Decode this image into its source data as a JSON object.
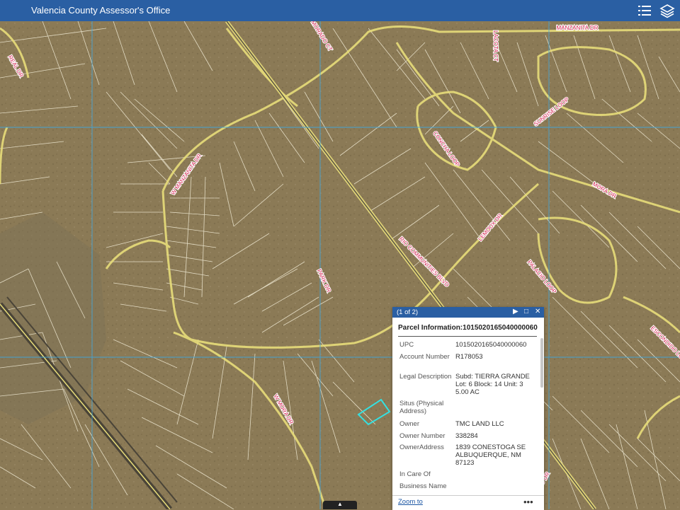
{
  "app": {
    "title": "Valencia County Assessor's Office",
    "icons": [
      "list-icon",
      "layers-icon"
    ]
  },
  "map": {
    "road_labels": [
      {
        "text": "MANZANITA DR"
      },
      {
        "text": "W MANZANITA DR"
      },
      {
        "text": "MORADO CT"
      },
      {
        "text": "LACOTA CT"
      },
      {
        "text": "SUNRISE LOOP"
      },
      {
        "text": "CONCHA LOOP"
      },
      {
        "text": "MORA DR"
      },
      {
        "text": "LEMOUX DR"
      },
      {
        "text": "RIO COMMUNITIES BLVD"
      },
      {
        "text": "PARK DR"
      },
      {
        "text": "PALACIO LOOP"
      },
      {
        "text": "W MORA DR"
      },
      {
        "text": "REAL DR"
      },
      {
        "text": "ESCONDIDO LOOP"
      },
      {
        "text": "AS DR"
      },
      {
        "text": "PASEO DR"
      }
    ],
    "colors": {
      "imagery": "#8b7a56",
      "parcel_line": "#f2ecd6",
      "road": "#e8dd7a",
      "grid": "#3fa8e0",
      "selection": "#35e0e0"
    }
  },
  "popup": {
    "counter": "(1 of 2)",
    "title": "Parcel Information:1015020165040000060",
    "fields": [
      {
        "label": "UPC",
        "value": "1015020165040000060"
      },
      {
        "label": "Account Number",
        "value": "R178053"
      },
      {
        "label": "Legal Description",
        "value": "Subd: TIERRA GRANDE Lot: 6 Block: 14 Unit: 3 5.00 AC"
      },
      {
        "label": "Situs (Physical Address)",
        "value": ""
      },
      {
        "label": "Owner",
        "value": "TMC LAND LLC"
      },
      {
        "label": "Owner Number",
        "value": "338284"
      },
      {
        "label": "OwnerAddress",
        "value": "1839 CONESTOGA SE ALBUQUERQUE, NM 87123"
      },
      {
        "label": "In Care Of",
        "value": ""
      },
      {
        "label": "Business Name",
        "value": ""
      }
    ],
    "zoom_label": "Zoom to",
    "more_label": "•••",
    "next_icon": "play-icon",
    "max_icon": "maximize-icon",
    "close_icon": "close-icon"
  },
  "bottom_tab": {
    "icon": "chevron-up-icon"
  }
}
